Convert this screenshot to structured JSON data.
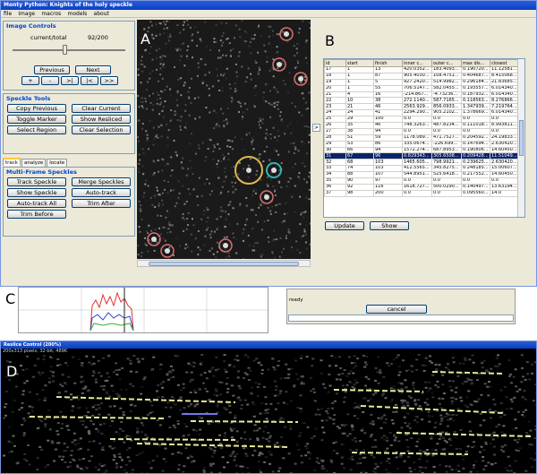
{
  "window": {
    "title": "Monty Python: Knights of the holy speckle",
    "menu": [
      "file",
      "image",
      "macros",
      "models",
      "about"
    ]
  },
  "image_controls": {
    "title": "Image Controls",
    "counter_label": "current/total",
    "counter_value": "92/200",
    "slider_position": 0.46,
    "previous": "Previous",
    "next": "Next",
    "plus": "+",
    "minus": "-",
    "step_forward": ">|",
    "step_back": "|<",
    "fast_forward": ">>"
  },
  "speckle_tools": {
    "title": "Speckle Tools",
    "copy_previous": "Copy Previous",
    "clear_current": "Clear Current",
    "toggle_marker": "Toggle Marker",
    "show_resliced": "Show Resliced",
    "select_region": "Select Region",
    "clear_selection": "Clear Selection"
  },
  "tabs": [
    "track",
    "analyze",
    "locate"
  ],
  "multi_frame": {
    "title": "Multi-Frame Speckles",
    "track_speckle": "Track Speckle",
    "merge_speckles": "Merge Speckles",
    "show_speckle": "Show Speckle",
    "auto_track": "Auto-track",
    "auto_track_all": "Auto-track All",
    "trim_after": "Trim After",
    "trim_before": "Trim Before"
  },
  "labels": {
    "a": "A",
    "b": "B",
    "c": "C",
    "d": "D"
  },
  "table": {
    "columns": [
      "id",
      "start",
      "finish",
      "inner c...",
      "outer c...",
      "max dis...",
      "closest"
    ],
    "selected_id": "31",
    "rows": [
      [
        "17",
        "1",
        "13",
        "420.0352...",
        "183.4093...",
        "0.190720...",
        "11.12581..."
      ],
      [
        "18",
        "1",
        "87",
        "905.4030...",
        "108.4751...",
        "0.404687...",
        "8.415068..."
      ],
      [
        "19",
        "1",
        "5",
        "927.2420...",
        "514.9982...",
        "0.296184...",
        "21.83685..."
      ],
      [
        "20",
        "1",
        "55",
        "706.5147...",
        "582.0455...",
        "0.193557...",
        "6.014340..."
      ],
      [
        "21",
        "4",
        "16",
        "-214.867...",
        "-4.73236...",
        "0.187932...",
        "6.014340..."
      ],
      [
        "22",
        "10",
        "38",
        "272.1140...",
        "587.7165...",
        "0.118563...",
        "8.276866..."
      ],
      [
        "23",
        "21",
        "46",
        "2563.929...",
        "856.0933...",
        "1.347939...",
        "7.219764..."
      ],
      [
        "24",
        "24",
        "41",
        "2294.290...",
        "905.2102...",
        "1.378669...",
        "6.014340..."
      ],
      [
        "25",
        "29",
        "100",
        "0.0",
        "0.0",
        "0.0",
        "0.0"
      ],
      [
        "26",
        "35",
        "46",
        "748.3263...",
        "487.8234...",
        "0.111018...",
        "8.993811..."
      ],
      [
        "27",
        "38",
        "94",
        "0.0",
        "0.0",
        "0.0",
        "0.0"
      ],
      [
        "28",
        "51",
        "59",
        "1178.089...",
        "471.7527...",
        "0.204592...",
        "24.19833..."
      ],
      [
        "29",
        "53",
        "86",
        "335.0674...",
        "-226.699...",
        "0.147694...",
        "2.630420..."
      ],
      [
        "30",
        "66",
        "94",
        "1572.274...",
        "687.8953...",
        "0.190806...",
        "14.60450..."
      ],
      [
        "31",
        "67",
        "96",
        "0.829343...",
        "305.6508...",
        "0.209428...",
        "11.51049..."
      ],
      [
        "32",
        "68",
        "103",
        "1465.605...",
        "798.9921...",
        "0.239625...",
        "2.630420..."
      ],
      [
        "33",
        "74",
        "103",
        "412.5565...",
        "345.8275...",
        "0.248185...",
        "15.00607..."
      ],
      [
        "34",
        "88",
        "107",
        "544.8951...",
        "525.6418...",
        "0.217552...",
        "14.60450..."
      ],
      [
        "35",
        "90",
        "97",
        "0.0",
        "0.0",
        "0.0",
        "0.0"
      ],
      [
        "36",
        "92",
        "116",
        "1618.727...",
        "500.0290...",
        "0.140497...",
        "13.63194..."
      ],
      [
        "37",
        "98",
        "200",
        "0.0",
        "0.0",
        "0.095560...",
        "14.0"
      ]
    ]
  },
  "table_actions": {
    "update": "Update",
    "show": "Show"
  },
  "status": {
    "message": "ready",
    "cancel": "cancel"
  },
  "reslice": {
    "title": "Reslice Control (200%)",
    "subtitle": "200x313 pixels; 32-bit; 489K"
  },
  "colors": {
    "marker_default": "#d9726e",
    "marker_selected": "#e2b84a",
    "marker_current": "#35b3b0",
    "selected_row": "#0a246a"
  }
}
